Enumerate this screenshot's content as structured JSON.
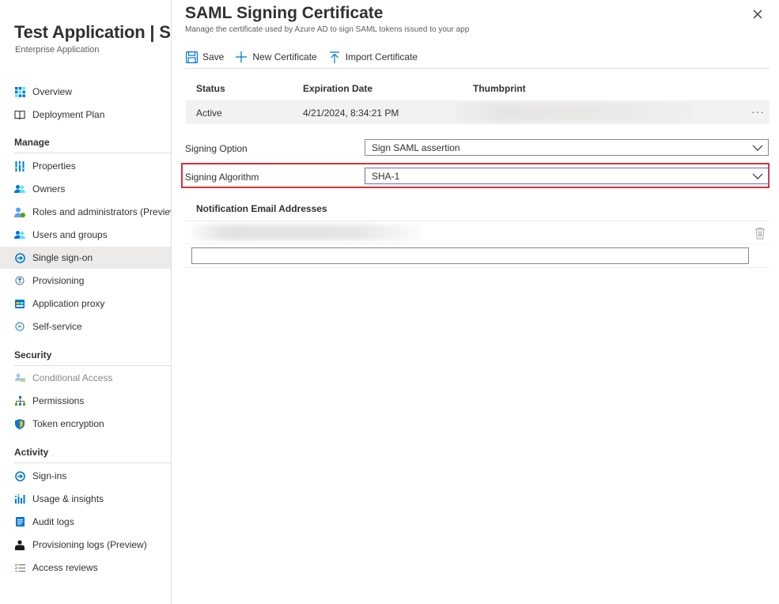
{
  "app": {
    "title": "Test Application | SAML-based Sign-on",
    "subtitle": "Enterprise Application"
  },
  "nav": {
    "top": [
      {
        "label": "Overview",
        "icon": "overview-grid-icon"
      },
      {
        "label": "Deployment Plan",
        "icon": "book-icon"
      }
    ],
    "manage_header": "Manage",
    "manage": [
      {
        "label": "Properties",
        "icon": "properties-icon"
      },
      {
        "label": "Owners",
        "icon": "owners-icon"
      },
      {
        "label": "Roles and administrators (Preview)",
        "icon": "roles-icon"
      },
      {
        "label": "Users and groups",
        "icon": "users-groups-icon"
      },
      {
        "label": "Single sign-on",
        "icon": "sso-icon",
        "selected": true
      },
      {
        "label": "Provisioning",
        "icon": "provisioning-icon"
      },
      {
        "label": "Application proxy",
        "icon": "app-proxy-icon"
      },
      {
        "label": "Self-service",
        "icon": "self-service-icon"
      }
    ],
    "security_header": "Security",
    "security": [
      {
        "label": "Conditional Access",
        "icon": "conditional-access-icon",
        "disabled": true
      },
      {
        "label": "Permissions",
        "icon": "permissions-icon"
      },
      {
        "label": "Token encryption",
        "icon": "shield-icon"
      }
    ],
    "activity_header": "Activity",
    "activity": [
      {
        "label": "Sign-ins",
        "icon": "sign-ins-icon"
      },
      {
        "label": "Usage & insights",
        "icon": "usage-chart-icon"
      },
      {
        "label": "Audit logs",
        "icon": "audit-logs-icon"
      },
      {
        "label": "Provisioning logs (Preview)",
        "icon": "provisioning-logs-icon"
      },
      {
        "label": "Access reviews",
        "icon": "access-reviews-icon"
      }
    ]
  },
  "blade": {
    "title": "SAML Signing Certificate",
    "subtitle": "Manage the certificate used by Azure AD to sign SAML tokens issued to your app"
  },
  "toolbar": {
    "save_label": "Save",
    "new_cert_label": "New Certificate",
    "import_cert_label": "Import Certificate"
  },
  "cert_table": {
    "headers": [
      "Status",
      "Expiration Date",
      "Thumbprint"
    ],
    "row": {
      "status": "Active",
      "expiration": "4/21/2024, 8:34:21 PM",
      "more": "···"
    }
  },
  "form": {
    "signing_option_label": "Signing Option",
    "signing_option_value": "Sign SAML assertion",
    "signing_algorithm_label": "Signing Algorithm",
    "signing_algorithm_value": "SHA-1"
  },
  "notifications": {
    "header": "Notification Email Addresses",
    "new_email_value": ""
  },
  "colors": {
    "accent": "#0078d4",
    "highlight_box": "#d13438",
    "selected_nav_bg": "#edebe9",
    "algo_select_border": "#8764b8"
  }
}
